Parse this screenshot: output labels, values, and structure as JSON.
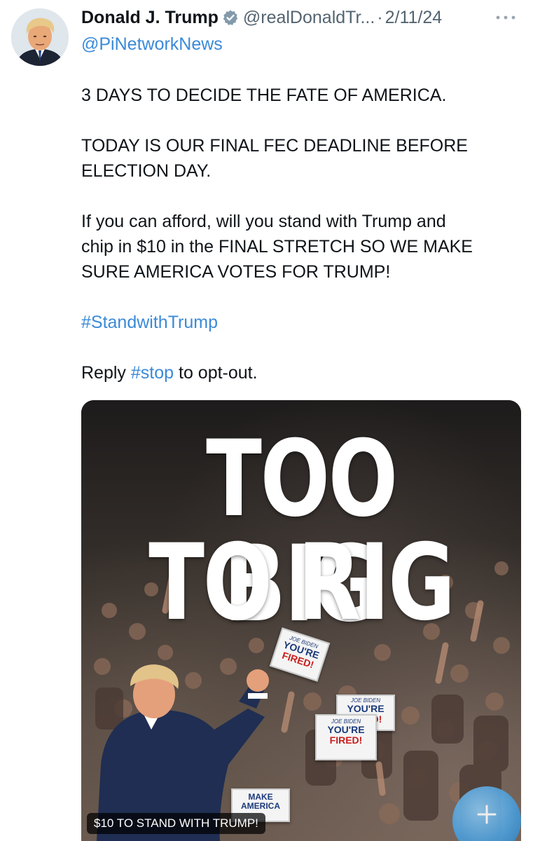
{
  "tweet": {
    "author_name": "Donald J. Trump",
    "author_handle": "@realDonaldTr...",
    "separator": "·",
    "date": "2/11/24",
    "reply_to": "@PiNetworkNews",
    "paragraphs": [
      "3 DAYS TO DECIDE THE FATE OF AMERICA.",
      "TODAY IS OUR FINAL FEC DEADLINE BEFORE\nELECTION DAY.",
      "If you can afford, will you stand with Trump and\nchip in $10 in the FINAL STRETCH SO WE MAKE\nSURE AMERICA VOTES FOR TRUMP!"
    ],
    "hashtag_line": "#StandwithTrump",
    "reply_prefix": "Reply ",
    "reply_hashtag": "#stop",
    "reply_suffix": " to opt-out."
  },
  "media": {
    "headline_line1": "TOO BIG",
    "headline_line2": "TO RIG",
    "caption": "$10 TO STAND WITH TRUMP!",
    "signs": [
      {
        "small": "JOE BIDEN",
        "big": "YOU'RE",
        "red": "FIRED!"
      },
      {
        "small": "JOE BIDEN",
        "big": "YOU'RE",
        "red": "FIRED!"
      },
      {
        "small": "JOE BIDEN",
        "big": "YOU'RE",
        "red": "FIRED!"
      }
    ],
    "make_america_sign": "MAKE AMERICA"
  },
  "icons": {
    "avatar": "profile-photo",
    "verified": "verified-badge-icon",
    "more": "more-options-icon",
    "compose": "compose-plus-icon"
  },
  "colors": {
    "link": "#3b8ad8",
    "muted": "#536471",
    "text": "#0f1419"
  }
}
